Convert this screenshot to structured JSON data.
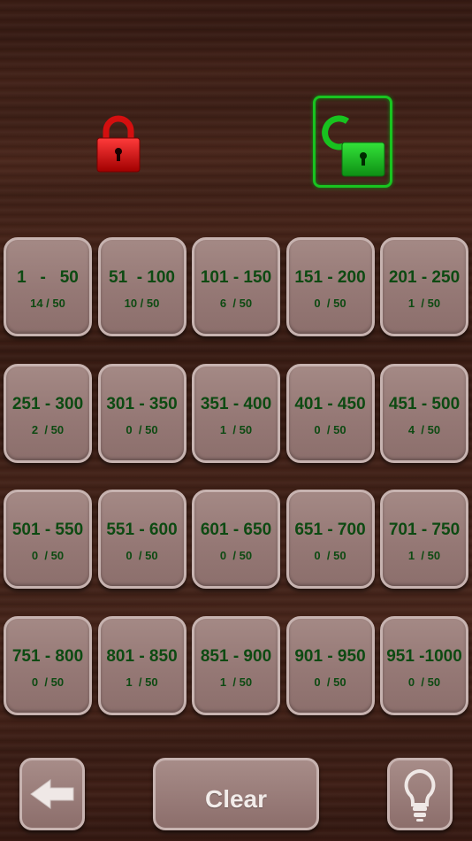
{
  "locks": {
    "locked": {
      "icon": "lock-closed-icon",
      "color": "#d10b0b"
    },
    "unlocked": {
      "icon": "lock-open-icon",
      "color": "#1ec724"
    }
  },
  "levels": [
    {
      "range": "1   -   50",
      "score": "14 / 50"
    },
    {
      "range": "51  - 100",
      "score": "10 / 50"
    },
    {
      "range": "101 - 150",
      "score": "6  / 50"
    },
    {
      "range": "151 - 200",
      "score": "0  / 50"
    },
    {
      "range": "201 - 250",
      "score": "1  / 50"
    },
    {
      "range": "251 - 300",
      "score": "2  / 50"
    },
    {
      "range": "301 - 350",
      "score": "0  / 50"
    },
    {
      "range": "351 - 400",
      "score": "1  / 50"
    },
    {
      "range": "401 - 450",
      "score": "0  / 50"
    },
    {
      "range": "451 - 500",
      "score": "4  / 50"
    },
    {
      "range": "501 - 550",
      "score": "0  / 50"
    },
    {
      "range": "551 - 600",
      "score": "0  / 50"
    },
    {
      "range": "601 - 650",
      "score": "0  / 50"
    },
    {
      "range": "651 - 700",
      "score": "0  / 50"
    },
    {
      "range": "701 - 750",
      "score": "1  / 50"
    },
    {
      "range": "751 - 800",
      "score": "0  / 50"
    },
    {
      "range": "801 - 850",
      "score": "1  / 50"
    },
    {
      "range": "851 - 900",
      "score": "1  / 50"
    },
    {
      "range": "901 - 950",
      "score": "0  / 50"
    },
    {
      "range": "951 -1000",
      "score": "0  / 50"
    }
  ],
  "toolbar": {
    "back_icon": "arrow-left-icon",
    "clear_label": "Clear",
    "hint_icon": "lightbulb-icon"
  },
  "colors": {
    "tile_text": "#0d4a12",
    "tile_face": "#957875",
    "tile_border": "#c7b3b0"
  }
}
